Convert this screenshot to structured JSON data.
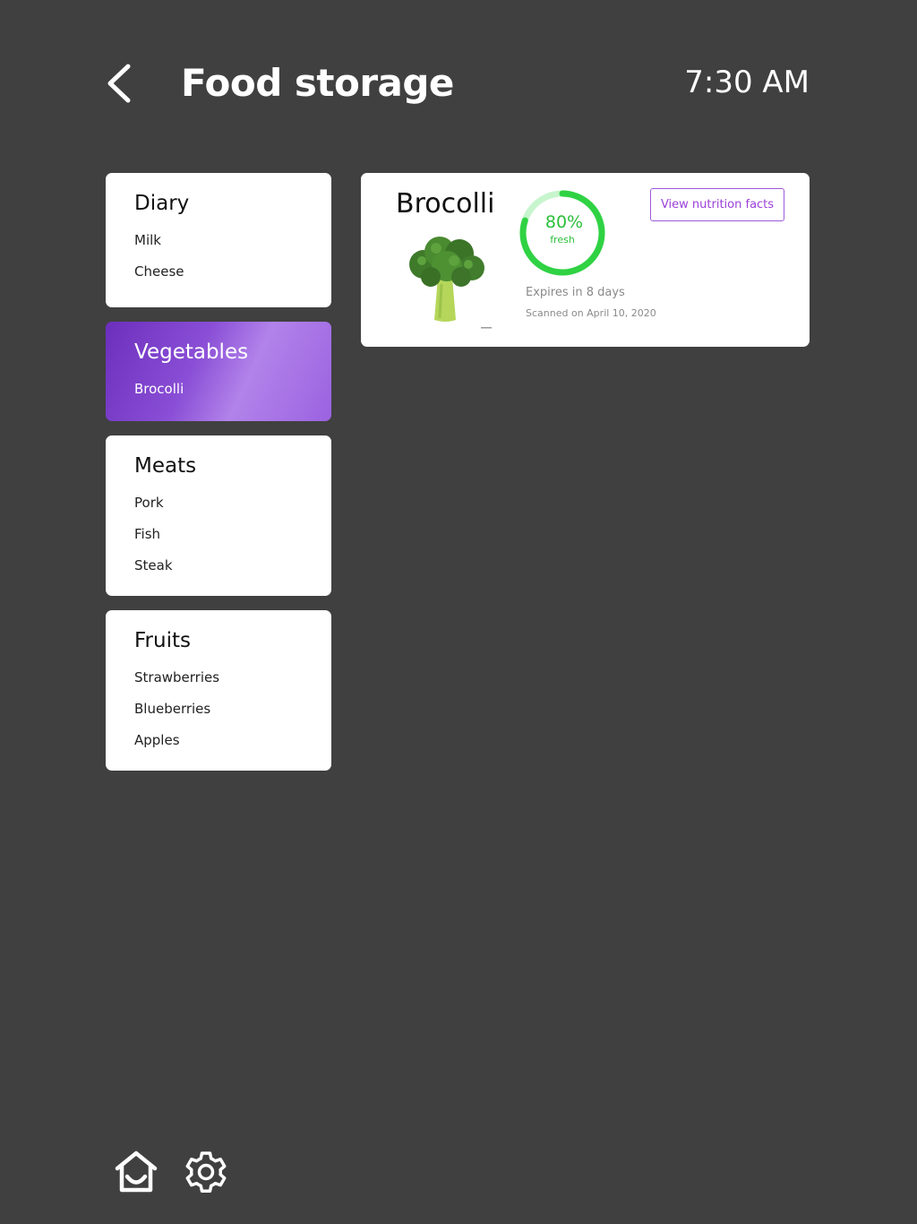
{
  "header": {
    "back_icon": "chevron-left-icon",
    "title": "Food storage",
    "time": "7:30 AM"
  },
  "categories": [
    {
      "title": "Diary",
      "items": [
        "Milk",
        "Cheese"
      ],
      "active": false
    },
    {
      "title": "Vegetables",
      "items": [
        "Brocolli"
      ],
      "active": true
    },
    {
      "title": "Meats",
      "items": [
        "Pork",
        "Fish",
        "Steak"
      ],
      "active": false
    },
    {
      "title": "Fruits",
      "items": [
        "Strawberries",
        "Blueberries",
        "Apples"
      ],
      "active": false
    }
  ],
  "detail": {
    "name": "Brocolli",
    "image_icon": "broccoli-image",
    "freshness": {
      "value": 0.8,
      "text": "80%",
      "label": "fresh",
      "color": "#2bbf3a"
    },
    "nutrition_button": "View nutrition facts",
    "expires": "Expires in 8 days",
    "scanned": "Scanned on April 10, 2020"
  },
  "bottom_bar": {
    "home_icon": "home-icon",
    "settings_icon": "gear-icon"
  },
  "colors": {
    "background": "#404040",
    "card": "#ffffff",
    "accent": "#9b3fd9",
    "active_gradient_start": "#6c2fbd",
    "active_gradient_end": "#b283ea"
  }
}
